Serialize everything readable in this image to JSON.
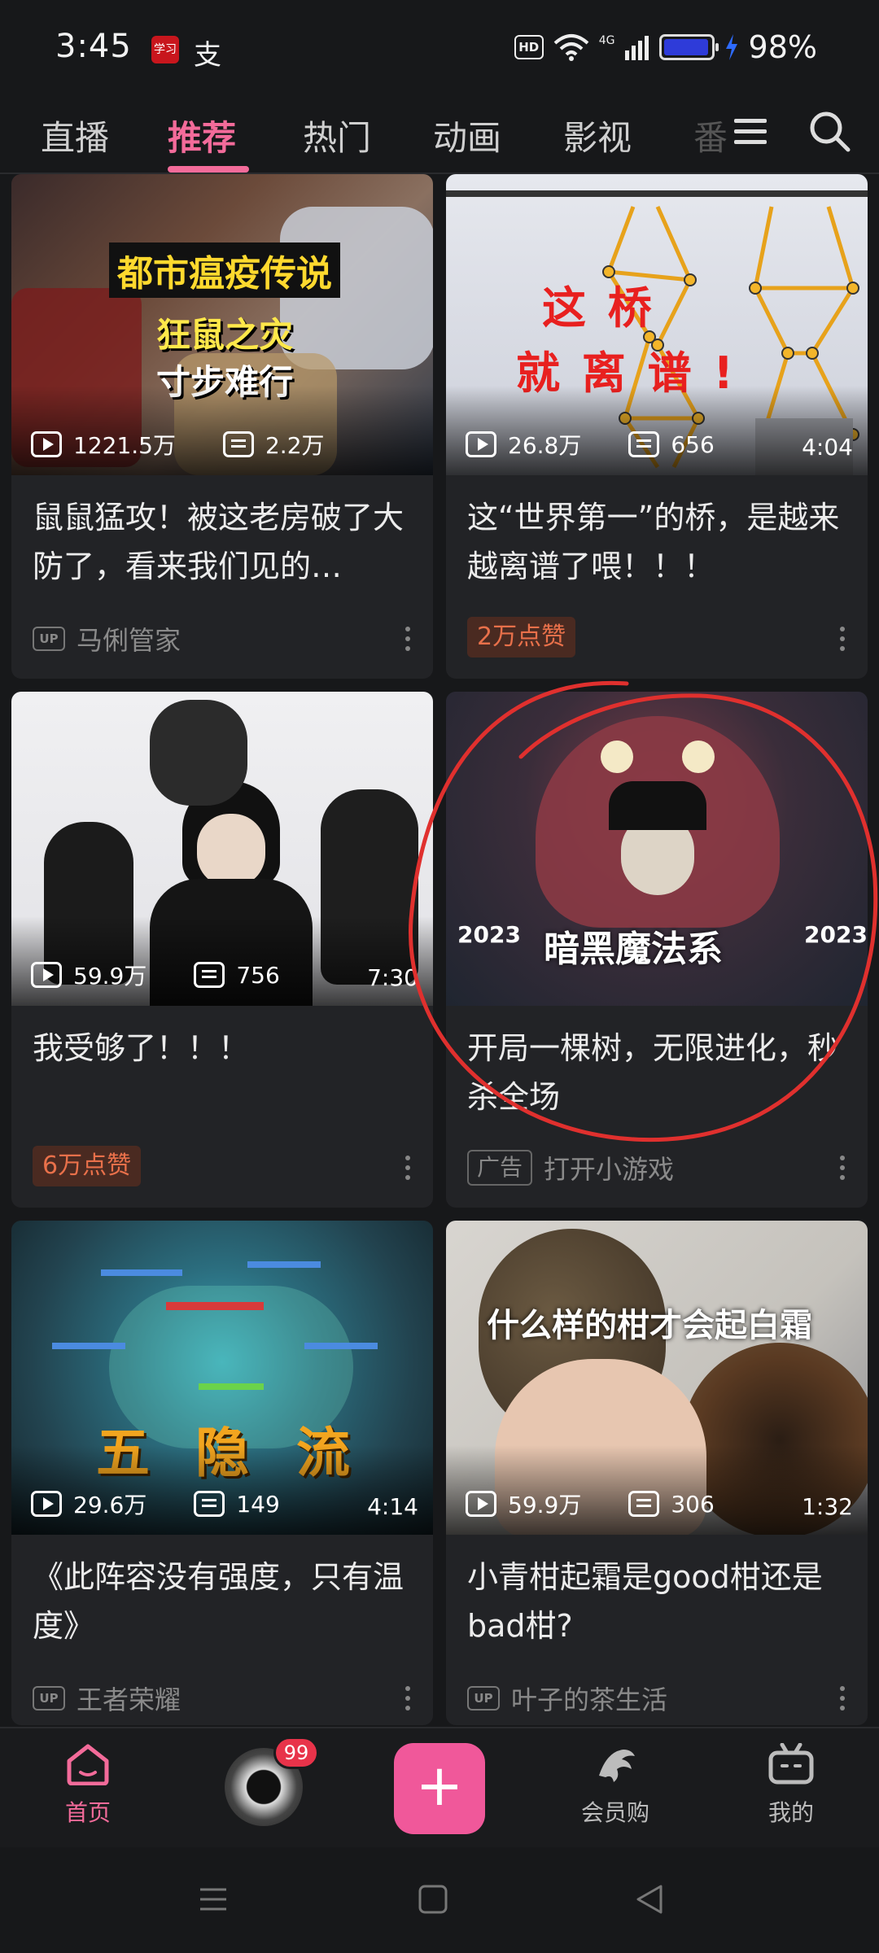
{
  "status_bar": {
    "time": "3:45",
    "hd": "HD",
    "signal": "4G",
    "battery_pct": "98%",
    "battery_level": 0.98,
    "app_icon_text": "学习",
    "app2_glyph": "支"
  },
  "tabs": [
    "直播",
    "推荐",
    "热门",
    "动画",
    "影视",
    "番"
  ],
  "active_tab": "推荐",
  "cards": [
    {
      "thumb_lines": [
        "都市瘟疫传说",
        "狂鼠之灾",
        "寸步难行"
      ],
      "views": "1221.5万",
      "danmaku": "2.2万",
      "duration": "",
      "title": "鼠鼠猛攻！被这老房破了大防了，看来我们见的…",
      "meta_type": "up",
      "up_badge": "UP",
      "meta_text": "马俐管家"
    },
    {
      "thumb_lines": [
        "这 桥",
        "就 离 谱 !"
      ],
      "views": "26.8万",
      "danmaku": "656",
      "duration": "4:04",
      "title": "这“世界第一”的桥，是越来越离谱了喂！！！",
      "meta_type": "like",
      "meta_text": "2万点赞"
    },
    {
      "thumb_lines": [],
      "views": "59.9万",
      "danmaku": "756",
      "duration": "7:30",
      "title": "我受够了！！！",
      "meta_type": "like",
      "meta_text": "6万点赞"
    },
    {
      "thumb_lines": [
        "暗黑魔法系",
        "2023",
        "2023"
      ],
      "views": "",
      "danmaku": "",
      "duration": "",
      "title": "开局一棵树，无限进化，秒杀全场",
      "meta_type": "ad",
      "ad_badge": "广告",
      "meta_text": "打开小游戏"
    },
    {
      "thumb_lines": [
        "五",
        "隐",
        "流"
      ],
      "views": "29.6万",
      "danmaku": "149",
      "duration": "4:14",
      "title": "《此阵容没有强度，只有温度》",
      "meta_type": "up",
      "up_badge": "UP",
      "meta_text": "王者荣耀"
    },
    {
      "thumb_lines": [
        "什么样的柑才会起白霜"
      ],
      "views": "59.9万",
      "danmaku": "306",
      "duration": "1:32",
      "title": "小青柑起霜是good柑还是bad柑?",
      "meta_type": "up",
      "up_badge": "UP",
      "meta_text": "叶子的茶生活"
    }
  ],
  "bottom_nav": {
    "home": "首页",
    "notif_count": "99",
    "plus": "+",
    "vip": "会员购",
    "mine": "我的"
  },
  "colors": {
    "accent": "#f36b9a",
    "like_tag": "#e8704a",
    "annotation": "#e0302e"
  }
}
